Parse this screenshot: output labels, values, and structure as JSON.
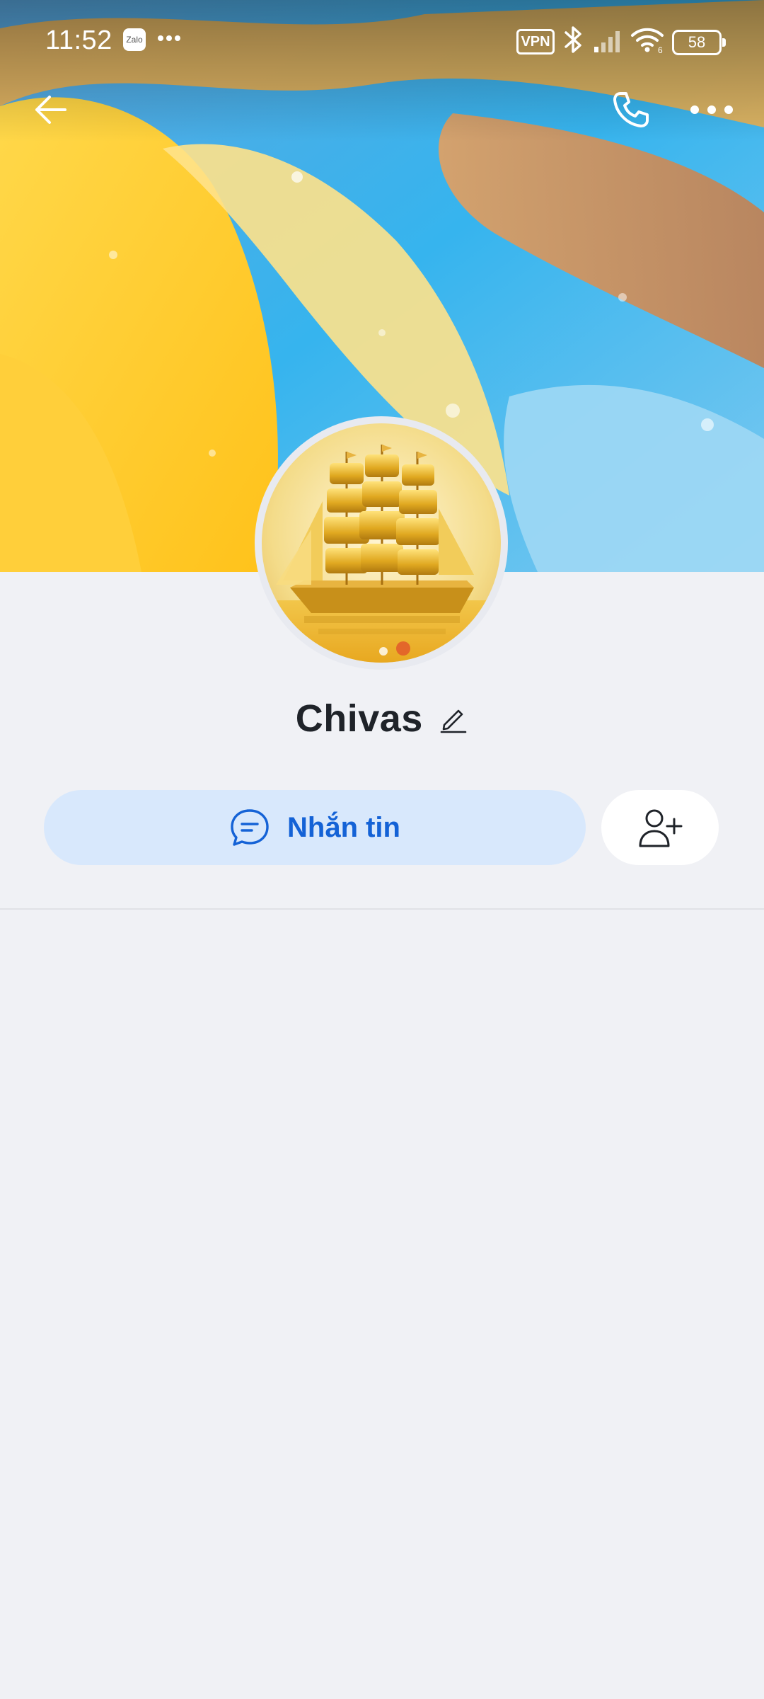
{
  "status_bar": {
    "time": "11:52",
    "app_badge": "Zalo",
    "vpn_label": "VPN",
    "wifi_label": "6",
    "battery_level": "58"
  },
  "top_nav": {
    "back_icon": "arrow-left-icon",
    "call_icon": "phone-icon",
    "more_icon": "more-horizontal-icon"
  },
  "profile": {
    "name": "Chivas",
    "edit_icon": "pencil-icon",
    "avatar_icon": "golden-sailing-ship-image"
  },
  "actions": {
    "message_label": "Nhắn tin",
    "message_icon": "chat-bubble-icon",
    "add_friend_icon": "add-user-icon"
  },
  "colors": {
    "accent": "#0a68ff",
    "message_button_bg": "#d8e8fc",
    "page_bg": "#f0f1f5",
    "name_text": "#1f2329"
  }
}
